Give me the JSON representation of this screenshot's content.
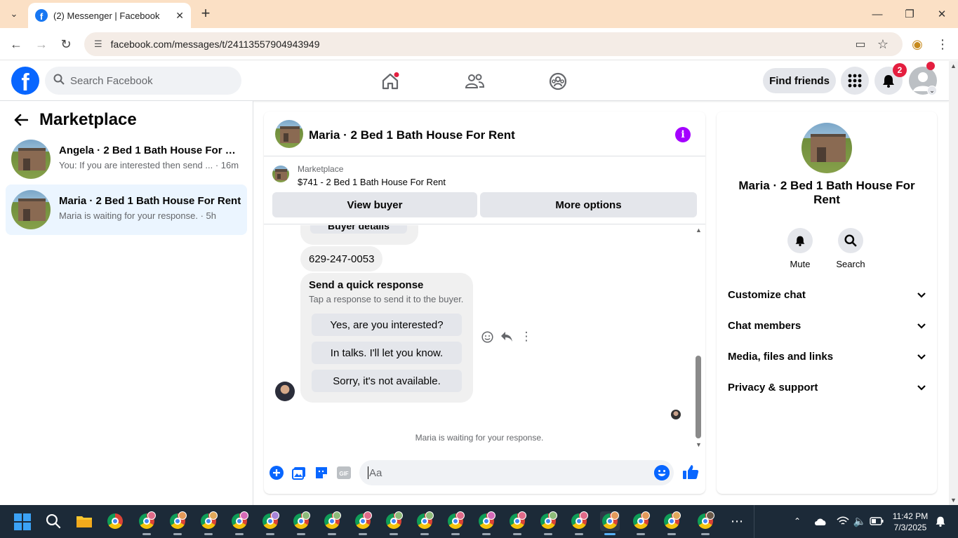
{
  "browser": {
    "tab_title": "(2) Messenger | Facebook",
    "url": "facebook.com/messages/t/24113557904943949"
  },
  "fb": {
    "search_placeholder": "Search Facebook",
    "find_friends_label": "Find friends",
    "notification_count": "2"
  },
  "sidebar": {
    "title": "Marketplace",
    "conversations": [
      {
        "name": "Angela · 2 Bed 1 Bath House For Rent",
        "preview": "You: If you are interested then send ... · 16m",
        "active": false
      },
      {
        "name": "Maria · 2 Bed 1 Bath House For Rent",
        "preview": "Maria is waiting for your response. · 5h",
        "active": true
      }
    ]
  },
  "chat": {
    "title": "Maria · 2 Bed 1 Bath House For Rent",
    "listing_source": "Marketplace",
    "listing_title": "$741 - 2 Bed 1 Bath House For Rent",
    "view_buyer_label": "View buyer",
    "more_options_label": "More options",
    "buyer_details_label": "Buyer details",
    "phone": "629-247-0053",
    "quick_response_title": "Send a quick response",
    "quick_response_sub": "Tap a response to send it to the buyer.",
    "quick_responses": [
      "Yes, are you interested?",
      "In talks. I'll let you know.",
      "Sorry, it's not available."
    ],
    "waiting_text": "Maria is waiting for your response.",
    "input_placeholder": "Aa"
  },
  "info_panel": {
    "name": "Maria · 2 Bed 1 Bath House For Rent",
    "mute_label": "Mute",
    "search_label": "Search",
    "sections": [
      "Customize chat",
      "Chat members",
      "Media, files and links",
      "Privacy & support"
    ]
  },
  "taskbar": {
    "time": "11:42 PM",
    "date": "7/3/2025"
  },
  "colors": {
    "fb_blue": "#0866ff",
    "messenger_purple": "#a400ff",
    "notification_red": "#e41e3f",
    "tabbar_bg": "#fbe0c5"
  }
}
